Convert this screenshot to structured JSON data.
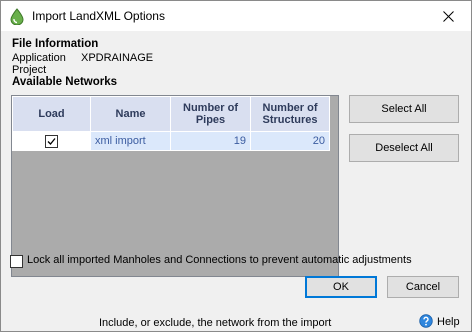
{
  "window": {
    "title": "Import LandXML Options"
  },
  "file_info": {
    "heading": "File Information",
    "application_label": "Application",
    "application_value": "XPDRAINAGE",
    "project_label": "Project"
  },
  "networks": {
    "heading": "Available Networks",
    "columns": [
      "Load",
      "Name",
      "Number of Pipes",
      "Number of Structures"
    ],
    "rows": [
      {
        "checked": true,
        "name": "xml import",
        "pipes": "19",
        "structures": "20"
      }
    ]
  },
  "buttons": {
    "select_all": "Select All",
    "deselect_all": "Deselect All",
    "ok": "OK",
    "cancel": "Cancel"
  },
  "lock_option": {
    "label": "Lock all imported Manholes and Connections to prevent automatic adjustments",
    "checked": false
  },
  "status_bar": {
    "text": "Include, or exclude, the network from the import",
    "help": "Help"
  }
}
